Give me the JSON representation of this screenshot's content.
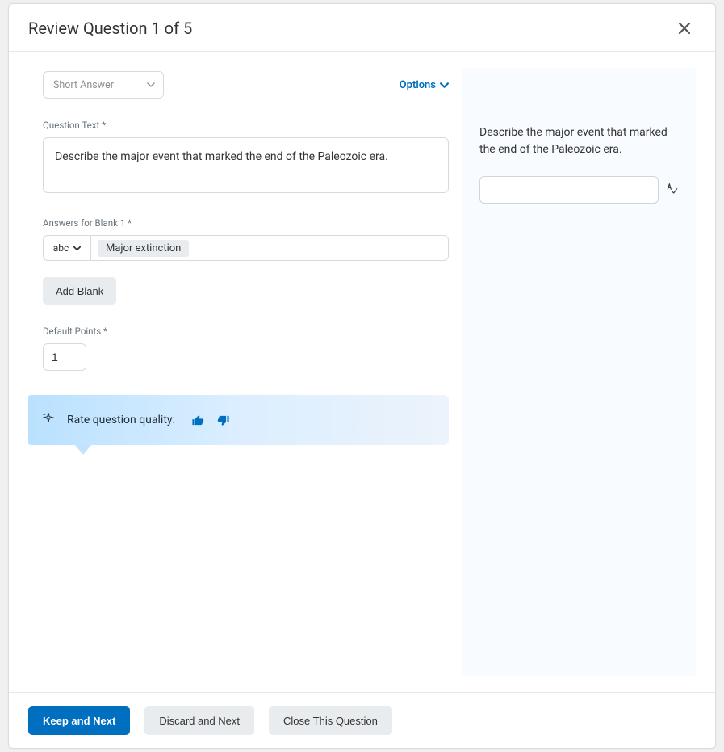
{
  "header": {
    "title": "Review Question 1 of 5"
  },
  "qtype": {
    "selected": "Short Answer"
  },
  "options_link": "Options",
  "labels": {
    "question_text": "Question Text *",
    "answers": "Answers for Blank 1 *",
    "default_points": "Default Points *"
  },
  "question_text": "Describe the major event that marked the end of the Paleozoic era.",
  "answer_mode": "abc",
  "answers": [
    "Major extinction"
  ],
  "add_blank": "Add Blank",
  "default_points": "1",
  "rate": {
    "label": "Rate question quality:"
  },
  "preview": {
    "text": "Describe the major event that marked the end of the Paleozoic era."
  },
  "footer": {
    "keep_next": "Keep and Next",
    "discard_next": "Discard and Next",
    "close": "Close This Question"
  }
}
